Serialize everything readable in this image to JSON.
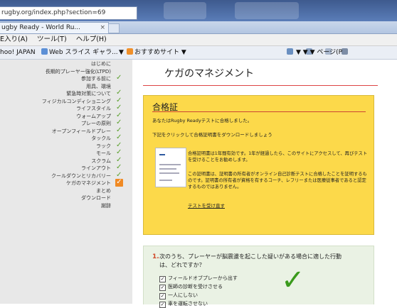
{
  "browser": {
    "url": "rugby.org/index.php?section=69",
    "tab_title": "ugby Ready - World Ru...",
    "tab_close": "×",
    "menu": [
      "E入り(A)",
      "ツール(T)",
      "ヘルプ(H)"
    ],
    "favorites": {
      "yahoo": "hoo! JAPAN",
      "webslice": "Web スライス ギャラ...",
      "dropdown": "▼",
      "suggested": "おすすめサイト ▼",
      "tools": "▼ ▼ ▼ ページ(P"
    }
  },
  "sidebar": {
    "items": [
      {
        "label": "はじめに",
        "check": false,
        "active": false
      },
      {
        "label": "長期的プレーヤー強化(LTPD)",
        "check": false,
        "active": false
      },
      {
        "label": "参加する前に",
        "check": true,
        "active": false
      },
      {
        "label": "用具、環境",
        "check": false,
        "active": false
      },
      {
        "label": "緊急時対策について",
        "check": true,
        "active": false
      },
      {
        "label": "フィジカルコンディショニング",
        "check": true,
        "active": false
      },
      {
        "label": "ライフスタイル",
        "check": true,
        "active": false
      },
      {
        "label": "ウォームアップ",
        "check": true,
        "active": false
      },
      {
        "label": "プレーの原則",
        "check": true,
        "active": false
      },
      {
        "label": "オープンフィールドプレー",
        "check": true,
        "active": false
      },
      {
        "label": "タックル",
        "check": true,
        "active": false
      },
      {
        "label": "ラック",
        "check": true,
        "active": false
      },
      {
        "label": "モール",
        "check": true,
        "active": false
      },
      {
        "label": "スクラム",
        "check": true,
        "active": false
      },
      {
        "label": "ラインアウト",
        "check": true,
        "active": false
      },
      {
        "label": "クールダウンとリカバリー",
        "check": true,
        "active": false
      },
      {
        "label": "ケガのマネジメント",
        "check": true,
        "active": true
      },
      {
        "label": "まとめ",
        "check": false,
        "active": false
      },
      {
        "label": "ダウンロード",
        "check": false,
        "active": false
      },
      {
        "label": "謝辞",
        "check": false,
        "active": false
      }
    ]
  },
  "main": {
    "title": "ケガのマネジメント",
    "certificate": {
      "heading": "合格証",
      "passed": "あなたはRugby Readyテストに合格しました。",
      "download": "下記をクリックして合格証明書をダウンロードしましょう",
      "validity": "合格証明書は1年間有効です。1年が経過したら、このサイトにアクセスして、再びテストを受けることをお勧めします。",
      "proof": "この証明書は、証明書の所有者がオンライン自己診断テストに合格したことを証明するものです。証明書の所有者が資格を有するコーチ、レフリーまたは医療従事者であると認定するものではありません。",
      "retake_link": "テストを受け直す"
    },
    "quiz": {
      "number": "1.",
      "question": "次のうち、プレーヤーが脳震盪を起こした疑いがある場合に適した行動は、どれですか？",
      "options": [
        "フィールドオブプレーから出す",
        "医師の診断を受けさせる",
        "一人にしない",
        "車を運転させない"
      ],
      "checkmark": "✓"
    }
  },
  "colors": {
    "accent_orange": "#f08a24",
    "check_green": "#5aa02c",
    "certificate_yellow": "#fcd94a",
    "quiz_number_red": "#d04a2a"
  }
}
